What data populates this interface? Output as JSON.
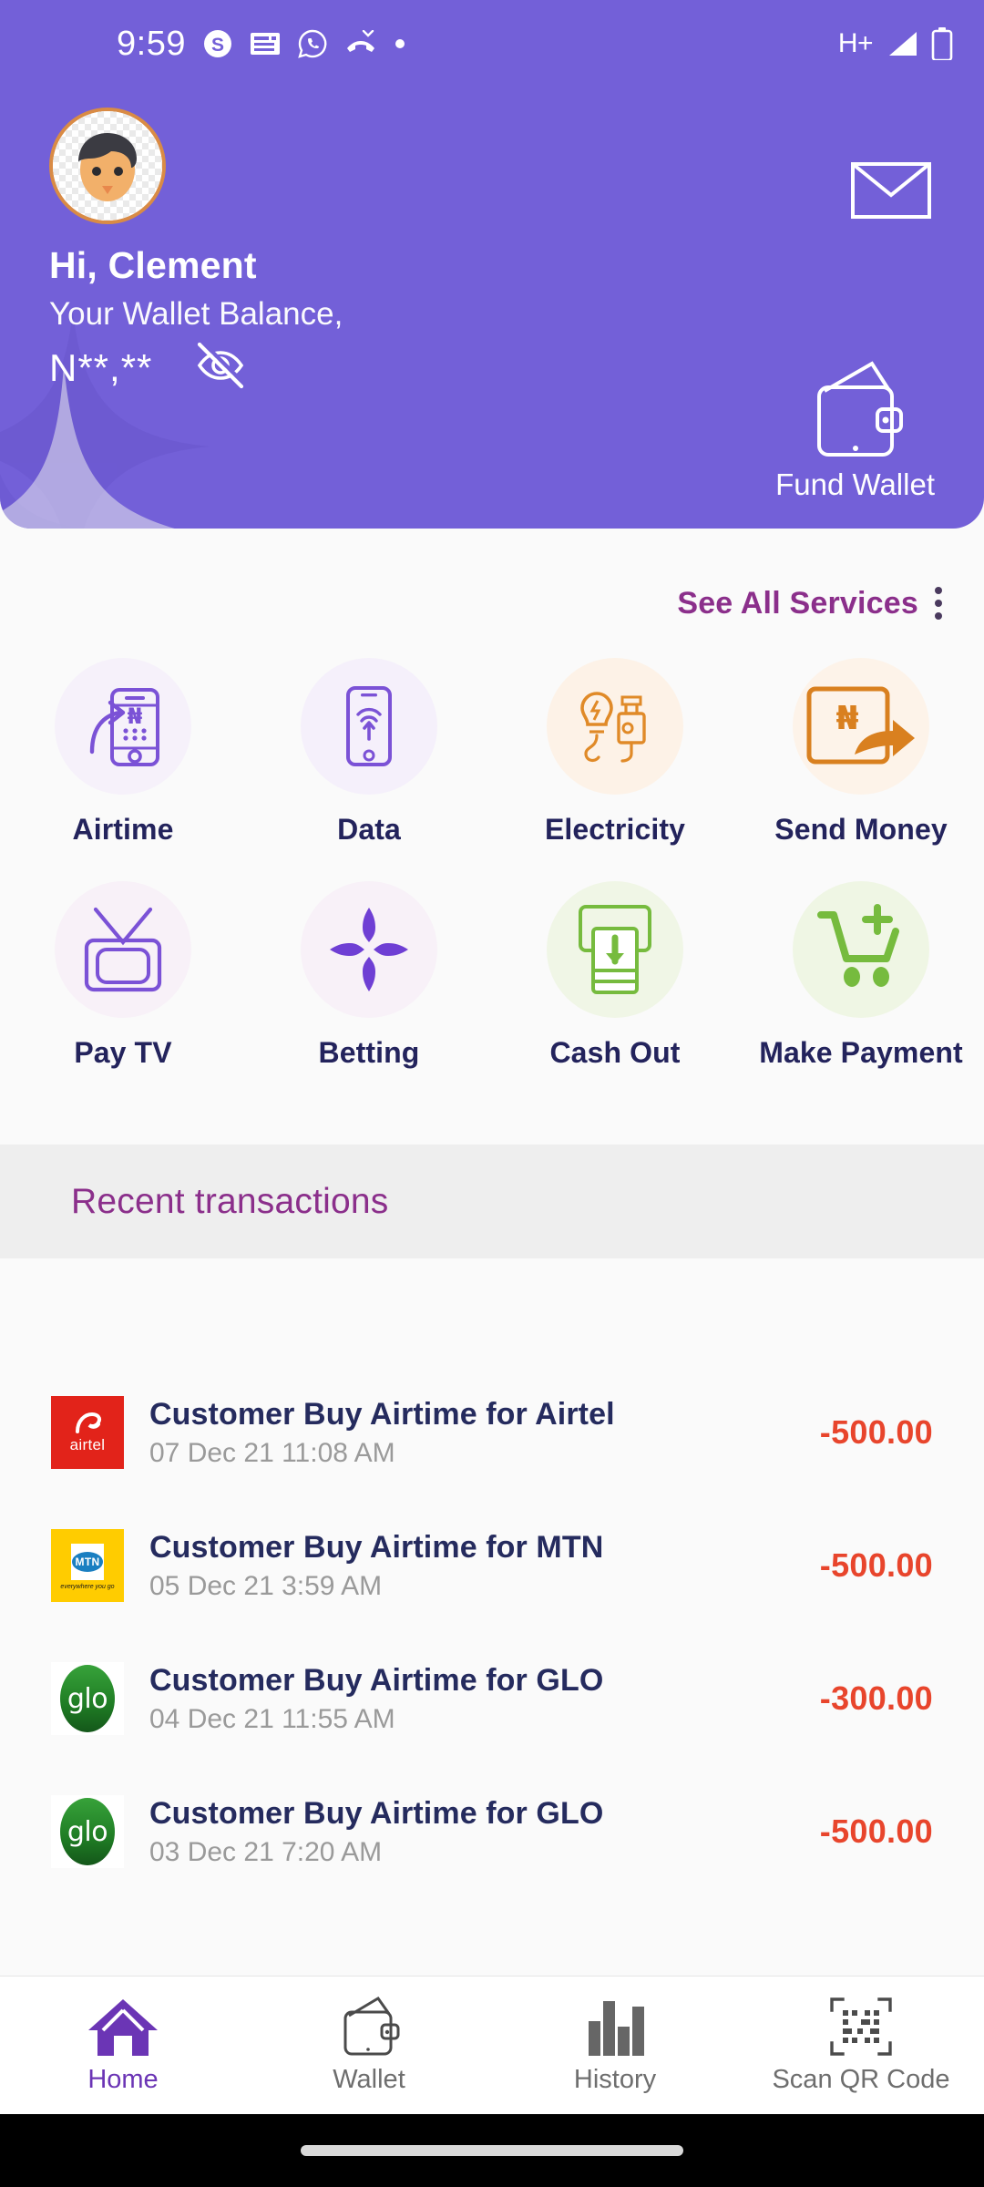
{
  "statusbar": {
    "time": "9:59",
    "icons": [
      "skype-icon",
      "news-icon",
      "whatsapp-icon",
      "missed-call-icon",
      "dot-icon"
    ],
    "network_type": "H+",
    "signal": "signal-icon",
    "battery": "battery-icon"
  },
  "header": {
    "accent_color": "#7360d8",
    "greeting": "Hi, Clement",
    "balance_label": "Your Wallet Balance,",
    "balance_value": "N**,**",
    "eye_toggle": "eye-off-icon",
    "mail_icon": "mail-icon",
    "avatar": "avatar",
    "fund_wallet": {
      "label": "Fund Wallet",
      "icon": "wallet-icon"
    }
  },
  "services": {
    "see_all_label": "See All Services",
    "see_all_color": "#8b2f8b",
    "kebab": "more-options-icon",
    "tiles": [
      {
        "label": "Airtime",
        "icon": "airtime-icon",
        "color": "#7b52d6",
        "bg": "#f6f1fa"
      },
      {
        "label": "Data",
        "icon": "data-icon",
        "color": "#7b52d6",
        "bg": "#f5f0fb"
      },
      {
        "label": "Electricity",
        "icon": "electricity-icon",
        "color": "#e08a28",
        "bg": "#fdf2e7"
      },
      {
        "label": "Send Money",
        "icon": "send-money-icon",
        "color": "#d9801f",
        "bg": "#fdf3e9"
      },
      {
        "label": "Pay TV",
        "icon": "pay-tv-icon",
        "color": "#7b52d6",
        "bg": "#f8f1f8"
      },
      {
        "label": "Betting",
        "icon": "betting-icon",
        "color": "#6f3fd4",
        "bg": "#f8f1f8"
      },
      {
        "label": "Cash Out",
        "icon": "cash-out-icon",
        "color": "#76bb3e",
        "bg": "#f0f6e6"
      },
      {
        "label": "Make Payment",
        "icon": "make-payment-icon",
        "color": "#76bb3e",
        "bg": "#eff6e4"
      }
    ]
  },
  "recent": {
    "title": "Recent transactions",
    "title_color": "#8b2f8b",
    "amount_color": "#e8452c",
    "transactions": [
      {
        "logo": "airtel-logo",
        "title": "Customer Buy Airtime for Airtel",
        "date": "07 Dec 21 11:08 AM",
        "amount": "-500.00"
      },
      {
        "logo": "mtn-logo",
        "title": "Customer Buy Airtime for MTN",
        "date": "05 Dec 21 3:59 AM",
        "amount": "-500.00"
      },
      {
        "logo": "glo-logo",
        "title": "Customer Buy Airtime for GLO",
        "date": "04 Dec 21 11:55 AM",
        "amount": "-300.00"
      },
      {
        "logo": "glo-logo",
        "title": "Customer Buy Airtime for GLO",
        "date": "03 Dec 21 7:20 AM",
        "amount": "-500.00"
      }
    ],
    "logos": {
      "airtel_word": "airtel",
      "mtn_word": "MTN",
      "mtn_tagline": "everywhere you go",
      "glo_word": "glo"
    }
  },
  "bottomnav": {
    "active": "Home",
    "active_color": "#6b35b5",
    "items": [
      {
        "label": "Home",
        "icon": "home-icon"
      },
      {
        "label": "Wallet",
        "icon": "wallet-icon"
      },
      {
        "label": "History",
        "icon": "bar-chart-icon"
      },
      {
        "label": "Scan QR Code",
        "icon": "qr-code-icon"
      }
    ]
  }
}
